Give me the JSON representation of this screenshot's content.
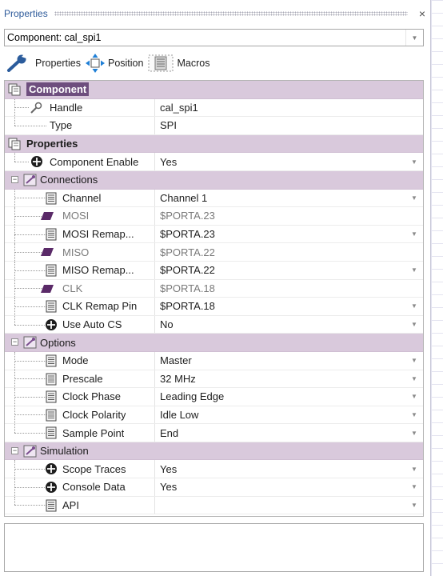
{
  "window": {
    "title": "Properties",
    "close_glyph": "×"
  },
  "component_select": {
    "value": "Component: cal_spi1",
    "arrow": "▼"
  },
  "toolbar": {
    "properties_label": "Properties",
    "position_label": "Position",
    "macros_label": "Macros"
  },
  "grid": {
    "component": {
      "label": "Component",
      "handle": {
        "name": "Handle",
        "value": "cal_spi1"
      },
      "type": {
        "name": "Type",
        "value": "SPI"
      }
    },
    "properties": {
      "label": "Properties",
      "component_enable": {
        "name": "Component Enable",
        "value": "Yes"
      }
    },
    "connections": {
      "label": "Connections",
      "items": [
        {
          "name": "Channel",
          "value": "Channel 1"
        },
        {
          "name": "MOSI",
          "value": "$PORTA.23"
        },
        {
          "name": "MOSI Remap...",
          "value": "$PORTA.23"
        },
        {
          "name": "MISO",
          "value": "$PORTA.22"
        },
        {
          "name": "MISO Remap...",
          "value": "$PORTA.22"
        },
        {
          "name": "CLK",
          "value": "$PORTA.18"
        },
        {
          "name": "CLK Remap Pin",
          "value": "$PORTA.18"
        },
        {
          "name": "Use Auto CS",
          "value": "No"
        }
      ]
    },
    "options": {
      "label": "Options",
      "items": [
        {
          "name": "Mode",
          "value": "Master"
        },
        {
          "name": "Prescale",
          "value": "32 MHz"
        },
        {
          "name": "Clock Phase",
          "value": "Leading Edge"
        },
        {
          "name": "Clock Polarity",
          "value": "Idle Low"
        },
        {
          "name": "Sample Point",
          "value": "End"
        }
      ]
    },
    "simulation": {
      "label": "Simulation",
      "items": [
        {
          "name": "Scope Traces",
          "value": "Yes"
        },
        {
          "name": "Console Data",
          "value": "Yes"
        },
        {
          "name": "API",
          "value": ""
        }
      ]
    },
    "expander_glyph": "−",
    "dropdown_glyph": "▼"
  },
  "colors": {
    "category_bg": "#d9c9dc",
    "selected_category_bg": "#6e4e7e",
    "title_text": "#2d5a9a",
    "readonly_text": "#7a7a7a"
  },
  "icons": {
    "toolbar": [
      "wrench-icon",
      "move-arrows-icon",
      "macros-icon"
    ],
    "rows": [
      "folder-pages-icon",
      "key-icon",
      "circle-plus-icon",
      "gear-sheet-icon",
      "list-sheet-icon",
      "pin-icon"
    ]
  }
}
